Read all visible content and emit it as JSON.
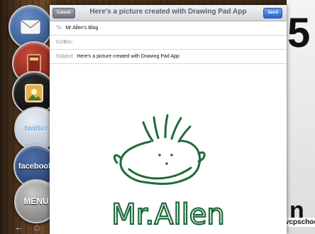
{
  "compose": {
    "cancel_label": "Cancel",
    "title": "Here's a picture created with Drawing Pad App",
    "send_label": "Send",
    "to_label": "To:",
    "to_value": "Mr Allen's Blog",
    "cc_label": "Cc/Bcc:",
    "subject_label": "Subject:",
    "subject_value": "Here's a picture created with Drawing Pad App"
  },
  "drawing": {
    "text": "Mr.Allen",
    "color": "#1f6b3a"
  },
  "dock": {
    "twitter_label": "twitter",
    "facebook_label": "facebook",
    "menu_label": "MENU"
  },
  "background": {
    "number": "5",
    "corner_letter": "n",
    "watermark": "wvcpschool.co"
  }
}
